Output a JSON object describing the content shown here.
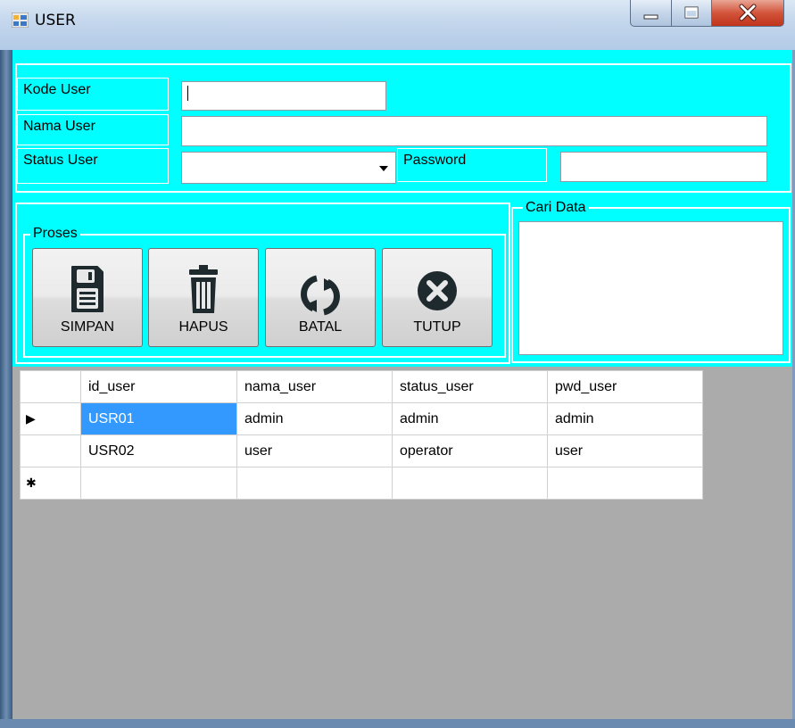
{
  "window": {
    "title": "USER"
  },
  "form": {
    "kode_label": "Kode User",
    "kode_value": "",
    "nama_label": "Nama User",
    "nama_value": "",
    "status_label": "Status User",
    "status_value": "",
    "password_label": "Password",
    "password_value": ""
  },
  "proses": {
    "title": "Proses",
    "buttons": [
      "SIMPAN",
      "HAPUS",
      "BATAL",
      "TUTUP"
    ]
  },
  "cari": {
    "title": "Cari Data"
  },
  "grid": {
    "columns": [
      "id_user",
      "nama_user",
      "status_user",
      "pwd_user"
    ],
    "rows": [
      [
        "USR01",
        "admin",
        "admin",
        "admin"
      ],
      [
        "USR02",
        "user",
        "operator",
        "user"
      ]
    ],
    "current_row_marker": "▶",
    "new_row_marker": "✱"
  },
  "colors": {
    "panel": "#00ffff",
    "grid_background": "#ababab",
    "selection": "#3399ff"
  }
}
